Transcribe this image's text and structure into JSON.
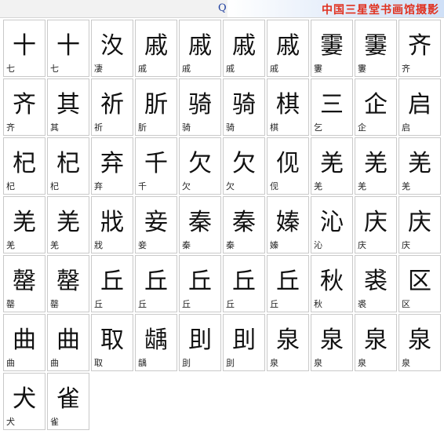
{
  "header": {
    "letter": "Q",
    "title": "中国三星堂书画馆摄影"
  },
  "characters": [
    {
      "glyph": "十",
      "label": "七"
    },
    {
      "glyph": "十",
      "label": "七"
    },
    {
      "glyph": "汷",
      "label": "凄"
    },
    {
      "glyph": "戚",
      "label": "戚"
    },
    {
      "glyph": "戚",
      "label": "戚"
    },
    {
      "glyph": "戚",
      "label": "戚"
    },
    {
      "glyph": "戚",
      "label": "戚"
    },
    {
      "glyph": "霋",
      "label": "霋"
    },
    {
      "glyph": "霋",
      "label": "霋"
    },
    {
      "glyph": "齐",
      "label": "齐"
    },
    {
      "glyph": "齐",
      "label": "齐"
    },
    {
      "glyph": "其",
      "label": "其"
    },
    {
      "glyph": "祈",
      "label": "祈"
    },
    {
      "glyph": "肵",
      "label": "肵"
    },
    {
      "glyph": "骑",
      "label": "骑"
    },
    {
      "glyph": "骑",
      "label": "骑"
    },
    {
      "glyph": "棋",
      "label": "棋"
    },
    {
      "glyph": "三",
      "label": "乞"
    },
    {
      "glyph": "企",
      "label": "企"
    },
    {
      "glyph": "启",
      "label": "启"
    },
    {
      "glyph": "杞",
      "label": "杞"
    },
    {
      "glyph": "杞",
      "label": "杞"
    },
    {
      "glyph": "弃",
      "label": "弃"
    },
    {
      "glyph": "千",
      "label": "千"
    },
    {
      "glyph": "欠",
      "label": "欠"
    },
    {
      "glyph": "欠",
      "label": "欠"
    },
    {
      "glyph": "伣",
      "label": "伣"
    },
    {
      "glyph": "羌",
      "label": "羌"
    },
    {
      "glyph": "羌",
      "label": "羌"
    },
    {
      "glyph": "羌",
      "label": "羌"
    },
    {
      "glyph": "羌",
      "label": "羌"
    },
    {
      "glyph": "羌",
      "label": "羌"
    },
    {
      "glyph": "戕",
      "label": "戕"
    },
    {
      "glyph": "妾",
      "label": "妾"
    },
    {
      "glyph": "秦",
      "label": "秦"
    },
    {
      "glyph": "秦",
      "label": "秦"
    },
    {
      "glyph": "嫀",
      "label": "嫀"
    },
    {
      "glyph": "沁",
      "label": "沁"
    },
    {
      "glyph": "庆",
      "label": "庆"
    },
    {
      "glyph": "庆",
      "label": "庆"
    },
    {
      "glyph": "罄",
      "label": "罄"
    },
    {
      "glyph": "罄",
      "label": "罄"
    },
    {
      "glyph": "丘",
      "label": "丘"
    },
    {
      "glyph": "丘",
      "label": "丘"
    },
    {
      "glyph": "丘",
      "label": "丘"
    },
    {
      "glyph": "丘",
      "label": "丘"
    },
    {
      "glyph": "丘",
      "label": "丘"
    },
    {
      "glyph": "秋",
      "label": "秋"
    },
    {
      "glyph": "裘",
      "label": "裘"
    },
    {
      "glyph": "区",
      "label": "区"
    },
    {
      "glyph": "曲",
      "label": "曲"
    },
    {
      "glyph": "曲",
      "label": "曲"
    },
    {
      "glyph": "取",
      "label": "取"
    },
    {
      "glyph": "龋",
      "label": "龋"
    },
    {
      "glyph": "刞",
      "label": "刞"
    },
    {
      "glyph": "刞",
      "label": "刞"
    },
    {
      "glyph": "泉",
      "label": "泉"
    },
    {
      "glyph": "泉",
      "label": "泉"
    },
    {
      "glyph": "泉",
      "label": "泉"
    },
    {
      "glyph": "泉",
      "label": "泉"
    },
    {
      "glyph": "犬",
      "label": "犬"
    },
    {
      "glyph": "雀",
      "label": "雀"
    }
  ]
}
